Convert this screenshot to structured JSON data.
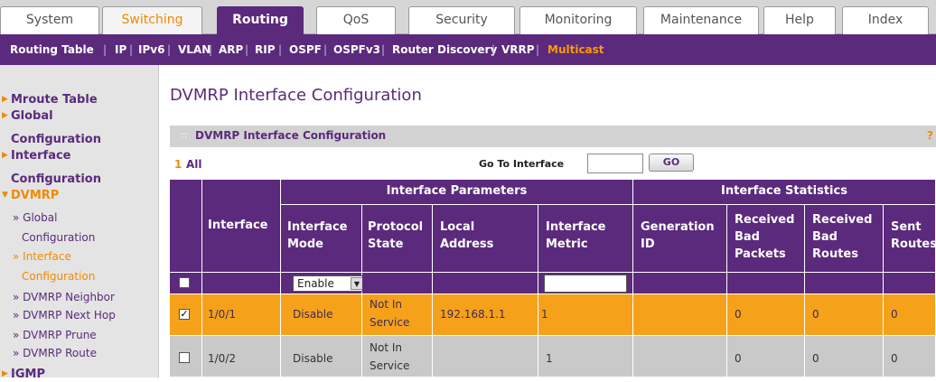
{
  "top_tabs": [
    "System",
    "Switching",
    "Routing",
    "QoS",
    "Security",
    "Monitoring",
    "Maintenance",
    "Help",
    "Index"
  ],
  "sub_nav": [
    "Routing Table",
    "IP",
    "IPv6",
    "VLAN",
    "ARP",
    "RIP",
    "OSPF",
    "OSPFv3",
    "Router Discovery",
    "VRRP",
    "Multicast"
  ],
  "left_nav": {
    "mroute": "Mroute Table",
    "global_1": "Global",
    "global_2": "Configuration",
    "iface_1": "Interface",
    "iface_2": "Configuration",
    "dvmrp": "DVMRP",
    "sub_global_1": "» Global",
    "sub_global_2": "Configuration",
    "sub_iface_1": "» Interface",
    "sub_iface_2": "Configuration",
    "neighbor": "» DVMRP Neighbor",
    "nexthop": "» DVMRP Next Hop",
    "prune": "» DVMRP Prune",
    "route": "» DVMRP Route",
    "igmp": "IGMP"
  },
  "page_title": "DVMRP Interface Configuration",
  "panel_title": "DVMRP Interface Configuration",
  "help_glyph": "?",
  "nav_row": {
    "page_num": "1",
    "all": "All",
    "go_to_label": "Go To Interface",
    "go_value": "",
    "go_button": "GO"
  },
  "table": {
    "group_params": "Interface Parameters",
    "group_stats": "Interface Statistics",
    "col_interface": "Interface",
    "col_mode_1": "Interface",
    "col_mode_2": "Mode",
    "col_state_1": "Protocol",
    "col_state_2": "State",
    "col_addr_1": "Local",
    "col_addr_2": "Address",
    "col_metric_1": "Interface",
    "col_metric_2": "Metric",
    "col_gen_1": "Generation",
    "col_gen_2": "ID",
    "col_rbp_1": "Received",
    "col_rbp_2": "Bad",
    "col_rbp_3": "Packets",
    "col_rbr_1": "Received",
    "col_rbr_2": "Bad",
    "col_rbr_3": "Routes",
    "col_sent_1": "Sent",
    "col_sent_2": "Routes",
    "edit_mode_value": "Enable",
    "rows": [
      {
        "interface": "1/0/1",
        "mode": "Disable",
        "state_1": "Not In",
        "state_2": "Service",
        "address": "192.168.1.1",
        "metric": "1",
        "gen_id": "",
        "bad_packets": "0",
        "bad_routes": "0",
        "sent": "0",
        "checked": true
      },
      {
        "interface": "1/0/2",
        "mode": "Disable",
        "state_1": "Not In",
        "state_2": "Service",
        "address": "",
        "metric": "1",
        "gen_id": "",
        "bad_packets": "0",
        "bad_routes": "0",
        "sent": "0",
        "checked": false
      }
    ]
  },
  "colors": {
    "purple": "#5b2a7c",
    "orange": "#f08a00",
    "row_selected": "#f5a21a",
    "row_gray": "#c9c9c9"
  }
}
